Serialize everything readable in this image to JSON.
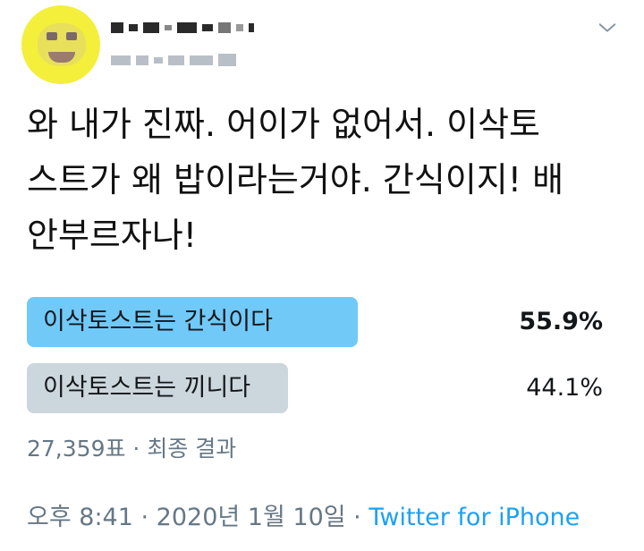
{
  "tweet": {
    "text": "와 내가 진짜. 어이가 없어서. 이삭토\n스트가 왜 밥이라는거야. 간식이지! 배\n안부르자나!"
  },
  "poll": {
    "options": [
      {
        "label": "이삭토스트는 간식이다",
        "percent": "55.9%",
        "fraction": 0.559,
        "bar_color": "#71c9f8",
        "winner": true
      },
      {
        "label": "이삭토스트는 끼니다",
        "percent": "44.1%",
        "fraction": 0.441,
        "bar_color": "#ccd6dd",
        "winner": false
      }
    ],
    "summary": "27,359표 · 최종 결과"
  },
  "meta": {
    "time": "오후 8:41",
    "separator1": " · ",
    "date": "2020년 1월 10일",
    "separator2": " · ",
    "source": "Twitter for iPhone"
  },
  "icons": {
    "avatar": "avatar-image",
    "caret": "chevron-down-icon"
  },
  "colors": {
    "accent": "#1da1f2",
    "muted_text": "#657786",
    "winner_bar": "#71c9f8",
    "other_bar": "#ccd6dd"
  }
}
